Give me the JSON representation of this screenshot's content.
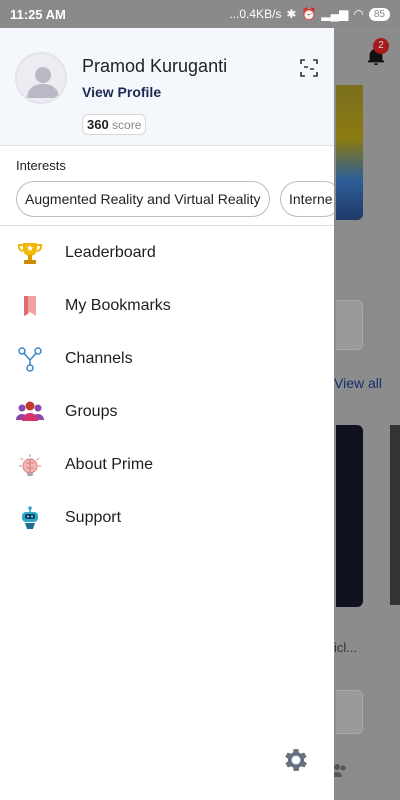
{
  "status_bar": {
    "time": "11:25 AM",
    "network_speed": "...0.4KB/s",
    "battery": "85"
  },
  "drawer": {
    "profile": {
      "name": "Pramod Kuruganti",
      "view_profile": "View Profile",
      "score_value": "360",
      "score_label": "score"
    },
    "interests": {
      "label": "Interests",
      "chips": [
        "Augmented Reality and Virtual Reality",
        "Interne"
      ]
    },
    "menu": [
      {
        "label": "Leaderboard",
        "icon": "trophy-icon"
      },
      {
        "label": "My Bookmarks",
        "icon": "bookmark-icon"
      },
      {
        "label": "Channels",
        "icon": "channels-icon"
      },
      {
        "label": "Groups",
        "icon": "groups-icon"
      },
      {
        "label": "About Prime",
        "icon": "brain-icon"
      },
      {
        "label": "Support",
        "icon": "robot-icon"
      }
    ]
  },
  "background": {
    "notification_count": "2",
    "view_all": "View all",
    "truncated_text": "icl..."
  },
  "colors": {
    "profile_bg": "#f4f8fd",
    "view_profile": "#1c2a4f",
    "badge": "#a51a1a"
  }
}
